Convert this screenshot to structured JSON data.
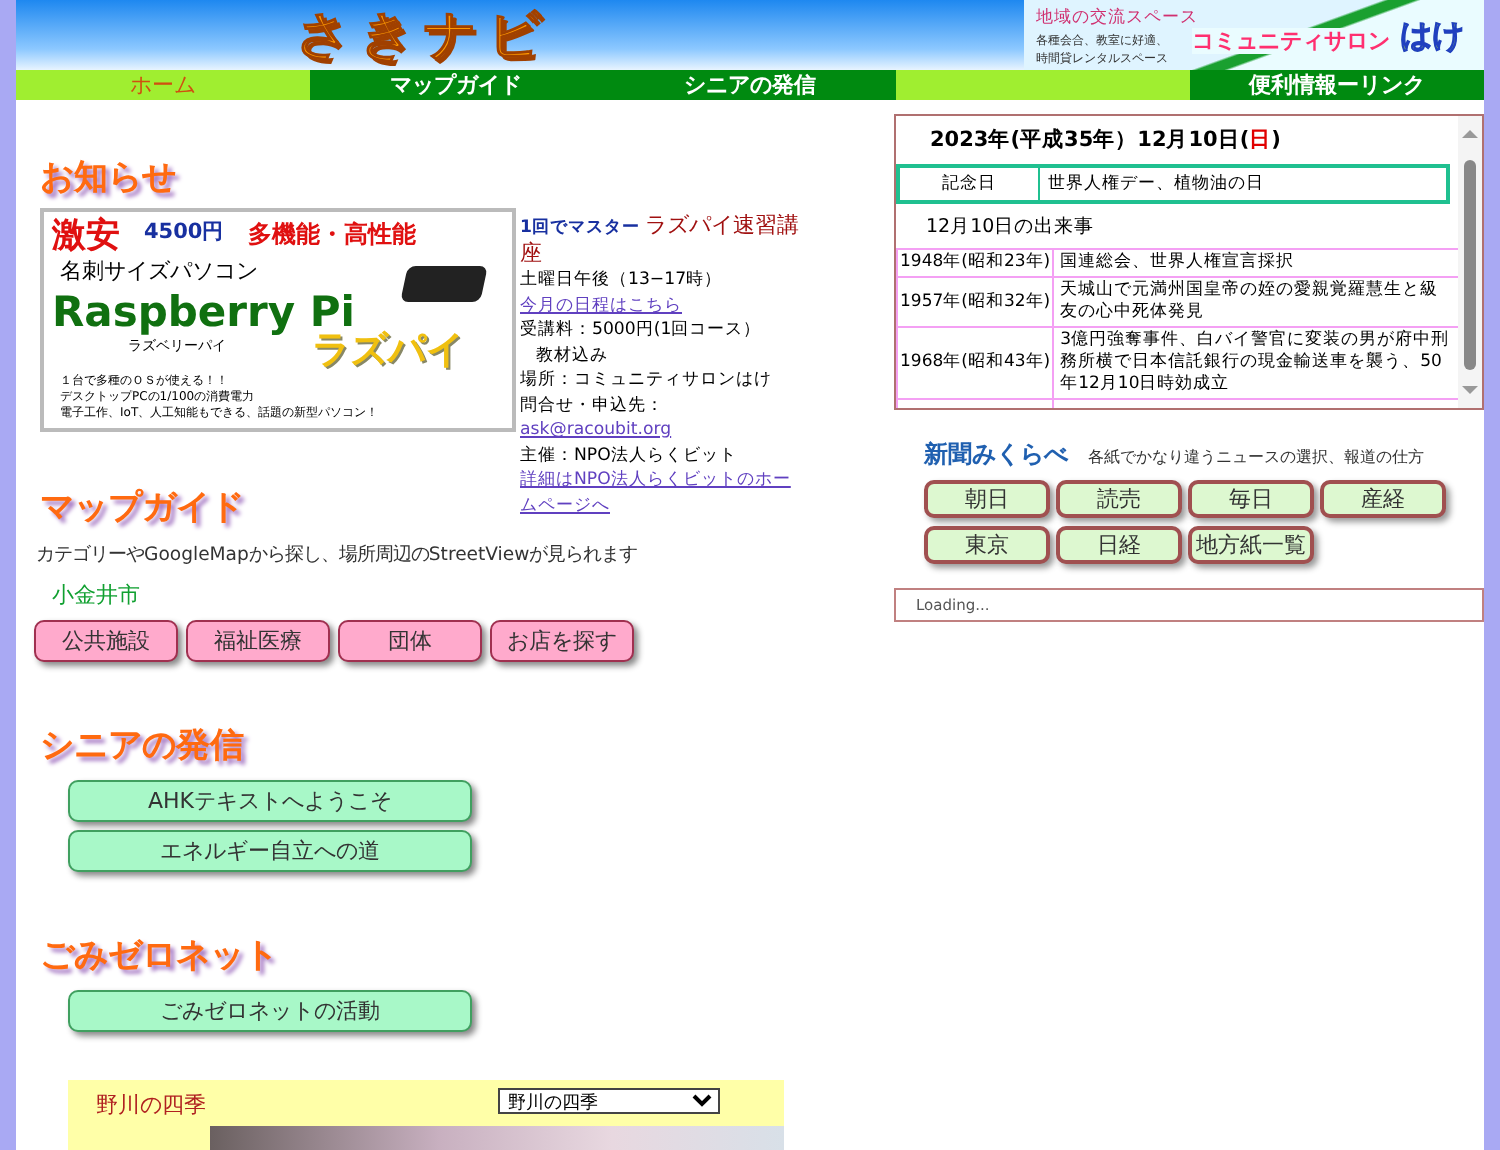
{
  "header": {
    "logo": "さきナビ",
    "ad": {
      "line1": "地域の交流スペース",
      "line2": "各種会合、教室に好適、",
      "line3": "時間貸レンタルスペース",
      "name": "コミュニティサロン",
      "name_suffix": "はけ"
    }
  },
  "nav": [
    {
      "label": "ホーム",
      "selected": true
    },
    {
      "label": "マップガイド",
      "selected": false
    },
    {
      "label": "シニアの発信",
      "selected": false
    },
    {
      "label": "便利情報ーリンク",
      "selected": false
    }
  ],
  "notice": {
    "heading": "お知らせ",
    "banner": {
      "headline": "激安",
      "price": "4500円",
      "features": "多機能・高性能",
      "subtitle": "名刺サイズパソコン",
      "product": "Raspberry Pi",
      "product_kana": "ラズベリーパイ",
      "nickname": "ラズパイ",
      "points": [
        "１台で多種のＯＳが使える！！",
        "デスクトップPCの1/100の消費電力",
        "電子工作、IoT、人工知能もできる、話題の新型パソコン！"
      ]
    },
    "info": {
      "lead": "1回でマスター",
      "course": "ラズパイ速習講座",
      "schedule": "土曜日午後（13−17時）",
      "schedule_link": "今月の日程はこちら",
      "fee": "受講料：5000円(1回コース）",
      "fee_note": "教材込み",
      "place": "場所：コミュニティサロンはけ",
      "contact": "問合せ・申込先：",
      "contact_link": "ask@racoubit.org",
      "organizer": "主催：NPO法人らくビット",
      "details_link": "詳細はNPO法人らくビットのホームページへ"
    }
  },
  "map_guide": {
    "heading": "マップガイド",
    "description": "カテゴリーやGoogleMapから探し、場所周辺のStreetViewが見られます",
    "city": "小金井市",
    "buttons": [
      "公共施設",
      "福祉医療",
      "団体",
      "お店を探す"
    ]
  },
  "senior": {
    "heading": "シニアの発信",
    "buttons": [
      "AHKテキストへようこそ",
      "エネルギー自立への道"
    ]
  },
  "gomi": {
    "heading": "ごみゼロネット",
    "buttons": [
      "ごみゼロネットの活動"
    ]
  },
  "seasons": {
    "title": "野川の四季",
    "select": "野川の四季"
  },
  "calendar": {
    "date": "2023年(平成35年）12月10日(",
    "weekday": "日",
    "weekday_sunday": true,
    "date_end": ")",
    "anniversary_label": "記念日",
    "anniversary": "世界人権デー、植物油の日",
    "events_heading": "12月10日の出来事",
    "events": [
      {
        "year": "1948年(昭和23年)",
        "text": "国連総会、世界人権宣言採択"
      },
      {
        "year": "1957年(昭和32年)",
        "text": "天城山で元満州国皇帝の姪の愛親覚羅慧生と級友の心中死体発見"
      },
      {
        "year": "1968年(昭和43年)",
        "text": "3億円強奪事件、白バイ警官に変装の男が府中刑務所横で日本信託銀行の現金輸送車を襲う、50年12月10日時効成立"
      }
    ]
  },
  "news": {
    "title": "新聞みくらべ",
    "subtitle": "各紙でかなり違うニュースの選択、報道の仕方",
    "buttons": [
      "朝日",
      "読売",
      "毎日",
      "産経",
      "東京",
      "日経",
      "地方紙一覧"
    ]
  },
  "loading": "Loading..."
}
